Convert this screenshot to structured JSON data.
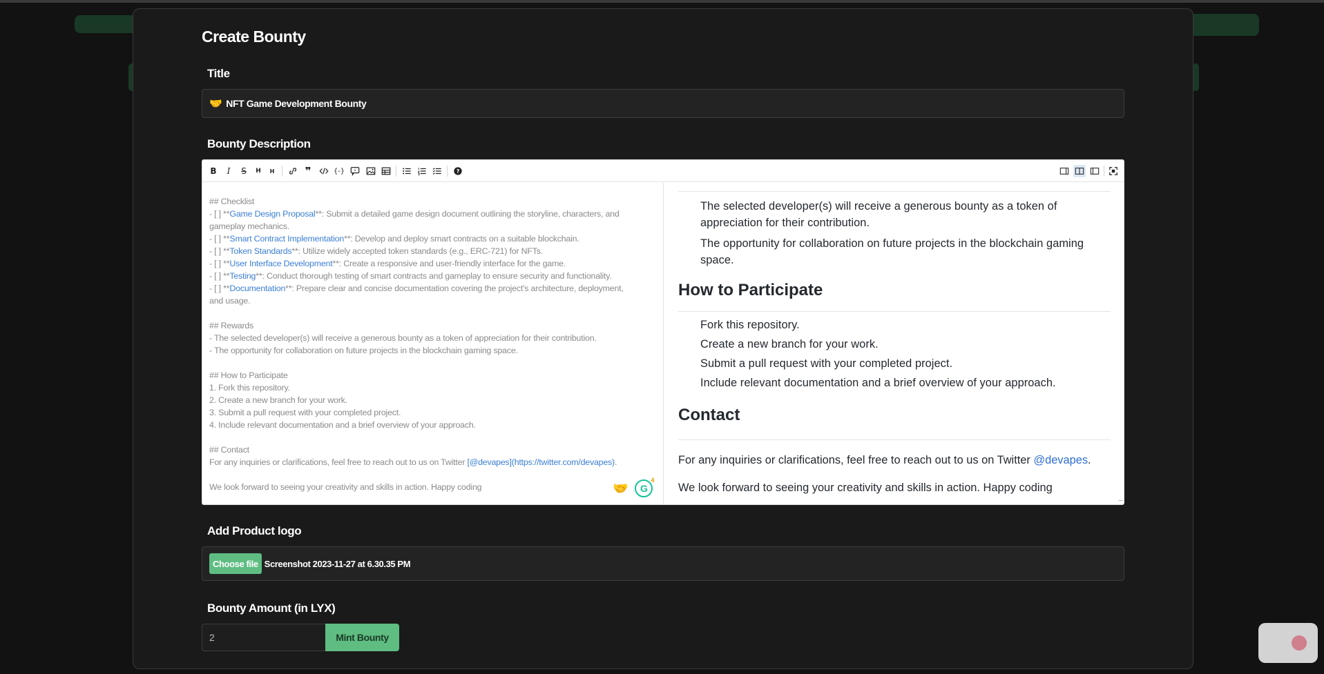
{
  "page": {
    "title": "Create Bounty"
  },
  "title_field": {
    "label": "Title",
    "emoji": "🤝",
    "value": "NFT Game Development Bounty"
  },
  "description": {
    "label": "Bounty Description",
    "markdown_lines": [
      {
        "pre": "## Checklist",
        "link": "",
        "post": ""
      },
      {
        "pre": "- [ ] **",
        "link": "Game Design Proposal",
        "post": "**: Submit a detailed game design document outlining the storyline, characters, and"
      },
      {
        "pre": "gameplay mechanics.",
        "link": "",
        "post": ""
      },
      {
        "pre": "- [ ] **",
        "link": "Smart Contract Implementation",
        "post": "**: Develop and deploy smart contracts on a suitable blockchain."
      },
      {
        "pre": "- [ ] **",
        "link": "Token Standards",
        "post": "**: Utilize widely accepted token standards (e.g., ERC-721) for NFTs."
      },
      {
        "pre": "- [ ] **",
        "link": "User Interface Development",
        "post": "**: Create a responsive and user-friendly interface for the game."
      },
      {
        "pre": "- [ ] **",
        "link": "Testing",
        "post": "**: Conduct thorough testing of smart contracts and gameplay to ensure security and functionality."
      },
      {
        "pre": "- [ ] **",
        "link": "Documentation",
        "post": "**: Prepare clear and concise documentation covering the project's architecture, deployment,"
      },
      {
        "pre": "and usage.",
        "link": "",
        "post": ""
      },
      {
        "pre": "",
        "link": "",
        "post": ""
      },
      {
        "pre": "## Rewards",
        "link": "",
        "post": ""
      },
      {
        "pre": "- The selected developer(s) will receive a generous bounty as a token of appreciation for their contribution.",
        "link": "",
        "post": ""
      },
      {
        "pre": "- The opportunity for collaboration on future projects in the blockchain gaming space.",
        "link": "",
        "post": ""
      },
      {
        "pre": "",
        "link": "",
        "post": ""
      },
      {
        "pre": "## How to Participate",
        "link": "",
        "post": ""
      },
      {
        "pre": "1. Fork this repository.",
        "link": "",
        "post": ""
      },
      {
        "pre": "2. Create a new branch for your work.",
        "link": "",
        "post": ""
      },
      {
        "pre": "3. Submit a pull request with your completed project.",
        "link": "",
        "post": ""
      },
      {
        "pre": "4. Include relevant documentation and a brief overview of your approach.",
        "link": "",
        "post": ""
      },
      {
        "pre": "",
        "link": "",
        "post": ""
      },
      {
        "pre": "## Contact",
        "link": "",
        "post": ""
      },
      {
        "pre": "For any inquiries or clarifications, feel free to reach out to us on Twitter ",
        "link": "[@devapes](https://twitter.com/devapes)",
        "post": "."
      },
      {
        "pre": "",
        "link": "",
        "post": ""
      },
      {
        "pre": "We look forward to seeing your creativity and skills in action. Happy coding",
        "link": "",
        "post": ""
      }
    ],
    "grammarly_badge": "4",
    "preview": {
      "rewards": [
        "The selected developer(s) will receive a generous bounty as a token of",
        "appreciation for their contribution.",
        "The opportunity for collaboration on future projects in the blockchain gaming",
        "space."
      ],
      "how_heading": "How to Participate",
      "how_items": [
        "Fork this repository.",
        "Create a new branch for your work.",
        "Submit a pull request with your completed project.",
        "Include relevant documentation and a brief overview of your approach."
      ],
      "contact_heading": "Contact",
      "contact_text": "For any inquiries or clarifications, feel free to reach out to us on Twitter ",
      "contact_link": "@devapes",
      "contact_end": ".",
      "closing": "We look forward to seeing your creativity and skills in action. Happy coding"
    }
  },
  "logo": {
    "label": "Add Product logo",
    "button": "Choose file",
    "file_name": "Screenshot 2023-11-27 at 6.30.35 PM"
  },
  "amount": {
    "label": "Bounty Amount (in LYX)",
    "value": "2",
    "submit": "Mint Bounty"
  }
}
